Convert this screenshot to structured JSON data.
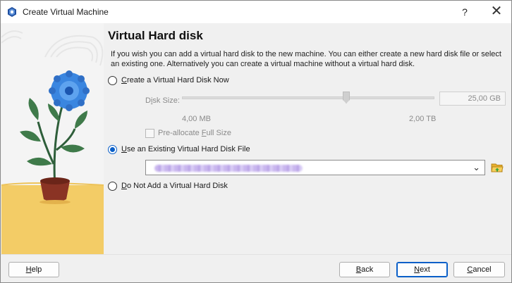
{
  "window": {
    "title": "Create Virtual Machine",
    "help_glyph": "?",
    "close_glyph": "✕"
  },
  "page": {
    "heading": "Virtual Hard disk",
    "description": "If you wish you can add a virtual hard disk to the new machine. You can either create a new hard disk file or select an existing one. Alternatively you can create a virtual machine without a virtual hard disk."
  },
  "options": {
    "create_new": {
      "label_pre": "",
      "label_mnemonic": "C",
      "label_post": "reate a Virtual Hard Disk Now",
      "selected": false
    },
    "use_existing": {
      "label_pre": "",
      "label_mnemonic": "U",
      "label_post": "se an Existing Virtual Hard Disk File",
      "selected": true
    },
    "no_disk": {
      "label_pre": "",
      "label_mnemonic": "D",
      "label_post": "o Not Add a Virtual Hard Disk",
      "selected": false
    }
  },
  "disk_size": {
    "label_pre": "D",
    "label_mnemonic": "i",
    "label_post": "sk Size:",
    "value": "25,00 GB",
    "min_label": "4,00 MB",
    "max_label": "2,00 TB",
    "slider_fraction": 0.65
  },
  "preallocate": {
    "label_pre": "Pre-allocate ",
    "label_mnemonic": "F",
    "label_post": "ull Size",
    "checked": false
  },
  "existing_file": {
    "selected_value": ""
  },
  "buttons": {
    "help": {
      "mnemonic": "H",
      "rest": "elp"
    },
    "back": {
      "mnemonic": "B",
      "rest": "ack"
    },
    "next": {
      "mnemonic": "N",
      "rest": "ext"
    },
    "cancel": {
      "pre": "",
      "mnemonic": "C",
      "rest": "ancel"
    }
  },
  "colors": {
    "accent": "#0a5fc8",
    "illustration_floor": "#f3cc66"
  },
  "icons": {
    "app": "virtualbox-icon",
    "folder": "folder-open-icon",
    "dropdown": "chevron-down-icon"
  }
}
